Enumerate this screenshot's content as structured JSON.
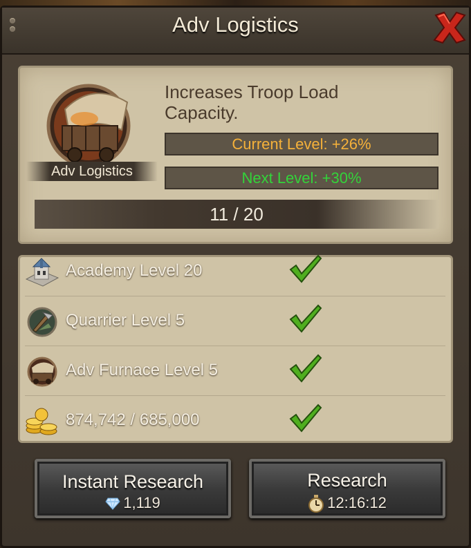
{
  "window": {
    "title": "Adv Logistics"
  },
  "research": {
    "icon_label": "Adv Logistics",
    "description": "Increases Troop Load Capacity.",
    "current_level": "Current Level: +26%",
    "next_level": "Next Level: +30%",
    "progress": "11 / 20",
    "progress_value": 0.55
  },
  "requirements": [
    {
      "icon": "academy-icon",
      "label": "Academy Level 20",
      "met": true
    },
    {
      "icon": "quarrier-icon",
      "label": "Quarrier Level 5",
      "met": true
    },
    {
      "icon": "adv-furnace-icon",
      "label": "Adv Furnace Level 5",
      "met": true
    },
    {
      "icon": "gold-coins-icon",
      "label": "874,742 / 685,000",
      "met": true
    }
  ],
  "buttons": {
    "instant": {
      "label": "Instant Research",
      "cost": "1,119",
      "cost_icon": "gem-icon"
    },
    "research": {
      "label": "Research",
      "time": "12:16:12",
      "time_icon": "stopwatch-icon"
    }
  },
  "colors": {
    "current": "#f5b13a",
    "next": "#33d43a",
    "close": "#d8261c",
    "check": "#4fae1f"
  }
}
